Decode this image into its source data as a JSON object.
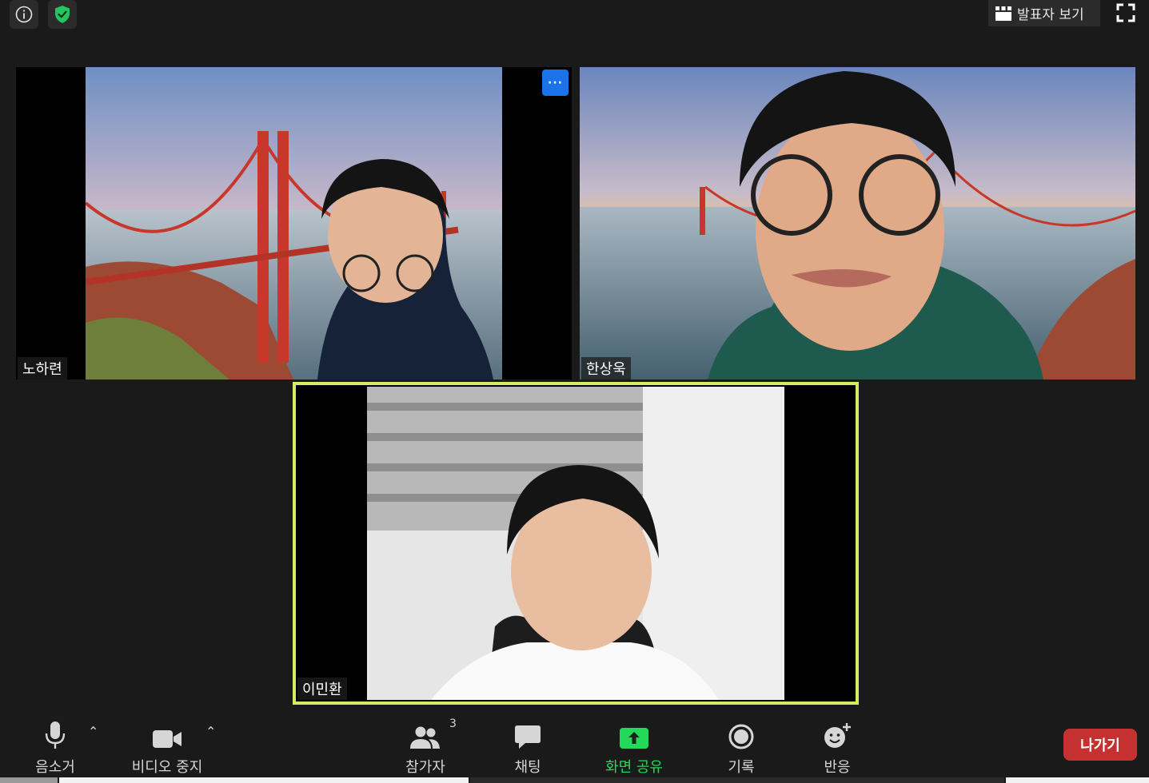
{
  "topbar": {
    "info_icon": "info-icon",
    "security_icon": "shield-check-icon",
    "speaker_view_label": "발표자 보기",
    "fullscreen_icon": "fullscreen-icon"
  },
  "participants": [
    {
      "name": "노하련",
      "background": "golden-gate-bridge",
      "has_more_button": true,
      "more_label": "···"
    },
    {
      "name": "한상욱",
      "background": "golden-gate-bridge"
    },
    {
      "name": "이민환",
      "background": "room",
      "active_speaker": true
    }
  ],
  "toolbar": {
    "mute_label": "음소거",
    "video_label": "비디오 중지",
    "participants_label": "참가자",
    "participants_count": "3",
    "chat_label": "채팅",
    "share_label": "화면 공유",
    "record_label": "기록",
    "reactions_label": "반응",
    "leave_label": "나가기",
    "caret": "⌃"
  },
  "colors": {
    "background": "#1a1a1a",
    "active_border": "#d8ea6a",
    "more_button": "#1a73e8",
    "share_green": "#23d959",
    "leave_red": "#c53030",
    "secure_green": "#22c55e"
  }
}
